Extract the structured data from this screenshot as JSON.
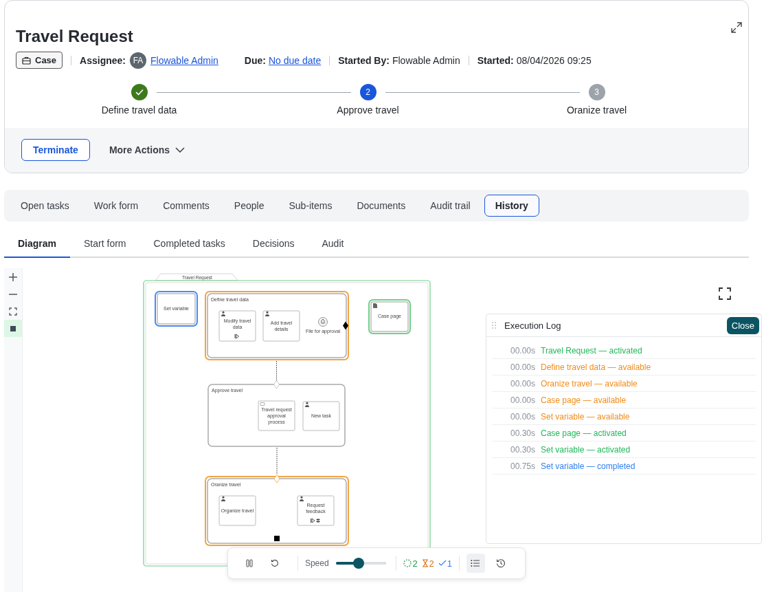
{
  "header": {
    "title": "Travel Request",
    "type_chip": "Case",
    "meta": [
      {
        "label": "Assignee:",
        "value": "Flowable Admin",
        "kind": "avatar-link",
        "avatar": "FA",
        "divider_before": true
      },
      {
        "label": "Due:",
        "value": "No due date",
        "kind": "link",
        "divider_before": false
      },
      {
        "label": "Started By:",
        "value": "Flowable Admin",
        "kind": "text",
        "divider_before": true
      },
      {
        "label": "Started:",
        "value": "08/04/2026 09:25",
        "kind": "text",
        "divider_before": true
      }
    ],
    "stages": [
      {
        "label": "Define travel data",
        "completed": true,
        "current": false
      },
      {
        "label": "Approve travel",
        "number": "2",
        "completed": false,
        "current": true
      },
      {
        "label": "Oranize travel",
        "number": "3",
        "completed": false,
        "current": false
      }
    ],
    "actions": {
      "primary": "Terminate",
      "menu": "More Actions"
    }
  },
  "tabs": [
    {
      "label": "Open tasks",
      "selected": false
    },
    {
      "label": "Work form",
      "selected": false
    },
    {
      "label": "Comments",
      "selected": false
    },
    {
      "label": "People",
      "selected": false
    },
    {
      "label": "Sub-items",
      "selected": false
    },
    {
      "label": "Documents",
      "selected": false
    },
    {
      "label": "Audit trail",
      "selected": false
    },
    {
      "label": "History",
      "selected": true
    }
  ],
  "subtabs": [
    {
      "label": "Diagram",
      "selected": true
    },
    {
      "label": "Start form",
      "selected": false
    },
    {
      "label": "Completed tasks",
      "selected": false
    },
    {
      "label": "Decisions",
      "selected": false
    },
    {
      "label": "Audit",
      "selected": false
    }
  ],
  "canvas_tools": [
    {
      "kind": "zoom-in",
      "selected": false
    },
    {
      "kind": "zoom-out",
      "selected": false
    },
    {
      "kind": "fit",
      "selected": false
    },
    {
      "kind": "minimap",
      "selected": true
    }
  ],
  "diagram": {
    "title": "Travel Request",
    "color": "#6fd08a",
    "nodes": [
      {
        "kind": "task",
        "label": "Set variable",
        "color": "#4a8af4"
      },
      {
        "kind": "stage",
        "label": "Define travel data",
        "color": "#f5a340",
        "exit_sentry": true,
        "children": [
          {
            "kind": "human-task",
            "label": "Modify travel data",
            "manual_activation": true
          },
          {
            "kind": "human-task",
            "label": "Add travel details"
          },
          {
            "kind": "milestone",
            "label": "File for approval"
          }
        ]
      },
      {
        "kind": "case-page",
        "label": "Case page",
        "color": "#6fd08a"
      },
      {
        "kind": "stage",
        "label": "Approve travel",
        "entry_sentry": true,
        "children": [
          {
            "kind": "process-task",
            "label": "Travel request approval process"
          },
          {
            "kind": "human-task",
            "label": "New task"
          }
        ]
      },
      {
        "kind": "stage",
        "label": "Oranize travel",
        "color": "#f5a340",
        "entry_sentry": true,
        "auto_complete": true,
        "children": [
          {
            "kind": "human-task",
            "label": "Organize travel"
          },
          {
            "kind": "human-task",
            "label": "Request feedback",
            "manual_activation": true,
            "repetition": true
          }
        ]
      }
    ]
  },
  "execution_log": {
    "title": "Execution Log",
    "close": "Close",
    "entries": [
      {
        "time": "00.00s",
        "text": "Travel Request — activated",
        "color": "#1fb85a"
      },
      {
        "time": "00.00s",
        "text": "Define travel data — available",
        "color": "#f08c1a"
      },
      {
        "time": "00.00s",
        "text": "Oranize travel — available",
        "color": "#f08c1a"
      },
      {
        "time": "00.00s",
        "text": "Case page — available",
        "color": "#f08c1a"
      },
      {
        "time": "00.00s",
        "text": "Set variable — available",
        "color": "#f08c1a"
      },
      {
        "time": "00.30s",
        "text": "Case page — activated",
        "color": "#1fb85a"
      },
      {
        "time": "00.30s",
        "text": "Set variable — activated",
        "color": "#1fb85a"
      },
      {
        "time": "00.75s",
        "text": "Set variable — completed",
        "color": "#2f7ff0"
      }
    ]
  },
  "player": {
    "speed_label": "Speed",
    "level": 0.45,
    "counts": [
      {
        "kind": "active",
        "value": "2"
      },
      {
        "kind": "waiting",
        "value": "2"
      },
      {
        "kind": "done",
        "value": "1"
      }
    ],
    "log_toggle": {
      "selected": true
    }
  }
}
